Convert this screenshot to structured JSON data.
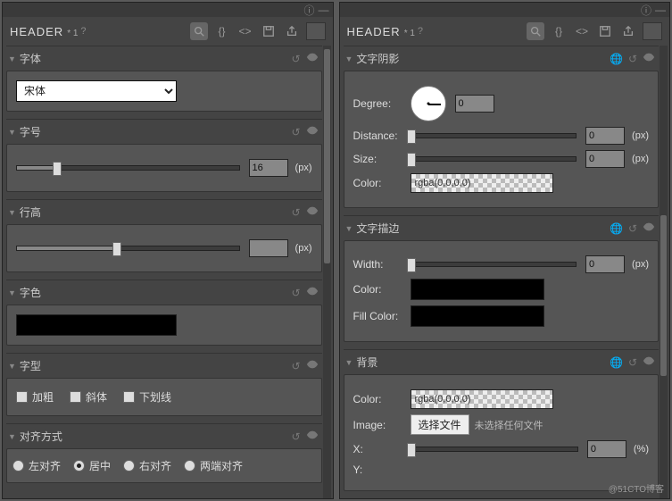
{
  "header": {
    "title": "HEADER",
    "sub": "* 1",
    "q": "?"
  },
  "left": {
    "font": {
      "label": "字体",
      "value": "宋体"
    },
    "size": {
      "label": "字号",
      "value": "16",
      "unit": "(px)",
      "pct": 18
    },
    "lineHeight": {
      "label": "行高",
      "value": "",
      "unit": "(px)",
      "pct": 45
    },
    "color": {
      "label": "字色"
    },
    "style": {
      "label": "字型",
      "bold": "加粗",
      "italic": "斜体",
      "underline": "下划线"
    },
    "align": {
      "label": "对齐方式",
      "left": "左对齐",
      "center": "居中",
      "right": "右对齐",
      "justify": "两端对齐",
      "selected": "center"
    }
  },
  "right": {
    "shadow": {
      "label": "文字阴影",
      "degree": {
        "lbl": "Degree:",
        "value": "0"
      },
      "distance": {
        "lbl": "Distance:",
        "value": "0",
        "unit": "(px)",
        "pct": 0
      },
      "size": {
        "lbl": "Size:",
        "value": "0",
        "unit": "(px)",
        "pct": 0
      },
      "color": {
        "lbl": "Color:",
        "value": "rgba(0,0,0,0)"
      }
    },
    "stroke": {
      "label": "文字描边",
      "width": {
        "lbl": "Width:",
        "value": "0",
        "unit": "(px)",
        "pct": 0
      },
      "color": {
        "lbl": "Color:"
      },
      "fill": {
        "lbl": "Fill Color:"
      }
    },
    "bg": {
      "label": "背景",
      "color": {
        "lbl": "Color:",
        "value": "rgba(0,0,0,0)"
      },
      "image": {
        "lbl": "Image:",
        "btn": "选择文件",
        "status": "未选择任何文件"
      },
      "x": {
        "lbl": "X:",
        "value": "0",
        "unit": "(%)",
        "pct": 0
      },
      "y": {
        "lbl": "Y:"
      }
    }
  },
  "watermark": "@51CTO博客"
}
